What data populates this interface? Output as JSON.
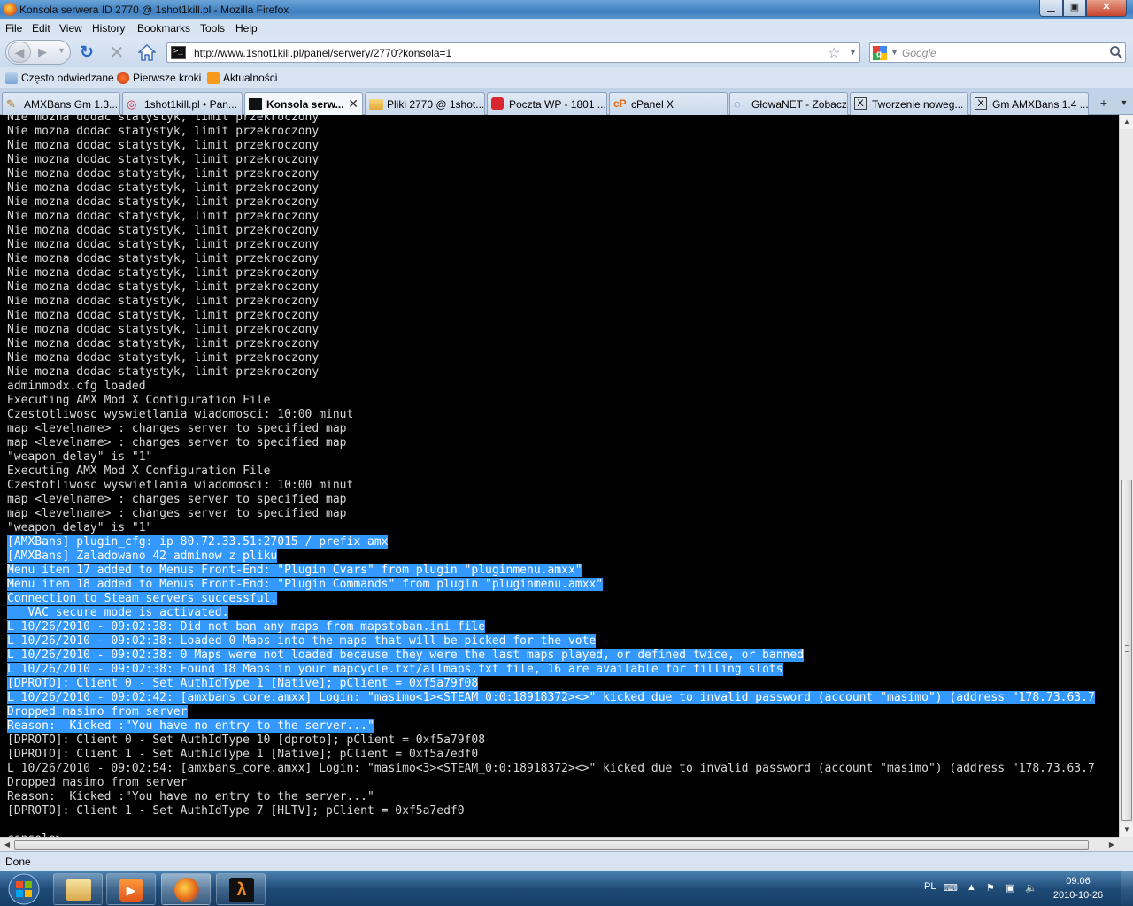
{
  "window": {
    "title": "Konsola serwera ID 2770 @ 1shot1kill.pl - Mozilla Firefox"
  },
  "menu": [
    "File",
    "Edit",
    "View",
    "History",
    "Bookmarks",
    "Tools",
    "Help"
  ],
  "nav": {
    "url": "http://www.1shot1kill.pl/panel/serwery/2770?konsola=1",
    "search_placeholder": "Google"
  },
  "bookmarks": [
    "Często odwiedzane",
    "Pierwsze kroki",
    "Aktualności"
  ],
  "tabs": [
    {
      "label": "AMXBans Gm 1.3...",
      "icon": "pen-icon"
    },
    {
      "label": "1shot1kill.pl • Pan...",
      "icon": "target-icon"
    },
    {
      "label": "Konsola serw...",
      "icon": "console-icon",
      "active": true
    },
    {
      "label": "Pliki 2770 @ 1shot...",
      "icon": "folder-icon"
    },
    {
      "label": "Poczta WP - 1801 ...",
      "icon": "wp-icon"
    },
    {
      "label": "cPanel X",
      "icon": "cpanel-icon"
    },
    {
      "label": "GłowaNET - Zobacz ...",
      "icon": "glowanet-icon"
    },
    {
      "label": "Tworzenie noweg...",
      "icon": "x-icon"
    },
    {
      "label": "Gm AMXBans 1.4 ...",
      "icon": "x-icon"
    }
  ],
  "console": {
    "lines": [
      "Nie mozna dodac statystyk, limit przekroczony",
      "Nie mozna dodac statystyk, limit przekroczony",
      "Nie mozna dodac statystyk, limit przekroczony",
      "Nie mozna dodac statystyk, limit przekroczony",
      "Nie mozna dodac statystyk, limit przekroczony",
      "Nie mozna dodac statystyk, limit przekroczony",
      "Nie mozna dodac statystyk, limit przekroczony",
      "Nie mozna dodac statystyk, limit przekroczony",
      "Nie mozna dodac statystyk, limit przekroczony",
      "Nie mozna dodac statystyk, limit przekroczony",
      "Nie mozna dodac statystyk, limit przekroczony",
      "Nie mozna dodac statystyk, limit przekroczony",
      "Nie mozna dodac statystyk, limit przekroczony",
      "Nie mozna dodac statystyk, limit przekroczony",
      "Nie mozna dodac statystyk, limit przekroczony",
      "Nie mozna dodac statystyk, limit przekroczony",
      "Nie mozna dodac statystyk, limit przekroczony",
      "Nie mozna dodac statystyk, limit przekroczony",
      "Nie mozna dodac statystyk, limit przekroczony",
      "adminmodx.cfg loaded",
      "Executing AMX Mod X Configuration File",
      "Czestotliwosc wyswietlania wiadomosci: 10:00 minut",
      "map <levelname> : changes server to specified map",
      "map <levelname> : changes server to specified map",
      "\"weapon_delay\" is \"1\"",
      "Executing AMX Mod X Configuration File",
      "Czestotliwosc wyswietlania wiadomosci: 10:00 minut",
      "map <levelname> : changes server to specified map",
      "map <levelname> : changes server to specified map",
      "\"weapon_delay\" is \"1\"",
      "[AMXBans] plugin_cfg: ip 80.72.33.51:27015 / prefix amx",
      "[AMXBans] Zaladowano 42 adminow z pliku",
      "Menu item 17 added to Menus Front-End: \"Plugin Cvars\" from plugin \"pluginmenu.amxx\"",
      "Menu item 18 added to Menus Front-End: \"Plugin Commands\" from plugin \"pluginmenu.amxx\"",
      "Connection to Steam servers successful.",
      "   VAC secure mode is activated.",
      "L 10/26/2010 - 09:02:38: Did not ban any maps from mapstoban.ini file",
      "L 10/26/2010 - 09:02:38: Loaded 0 Maps into the maps that will be picked for the vote",
      "L 10/26/2010 - 09:02:38: 0 Maps were not loaded because they were the last maps played, or defined twice, or banned",
      "L 10/26/2010 - 09:02:38: Found 18 Maps in your mapcycle.txt/allmaps.txt file, 16 are available for filling slots",
      "[DPROTO]: Client 0 - Set AuthIdType 1 [Native]; pClient = 0xf5a79f08",
      "L 10/26/2010 - 09:02:42: [amxbans_core.amxx] Login: \"masimo<1><STEAM_0:0:18918372><>\" kicked due to invalid password (account \"masimo\") (address \"178.73.63.7",
      "Dropped masimo from server",
      "Reason:  Kicked :\"You have no entry to the server...\"",
      "[DPROTO]: Client 0 - Set AuthIdType 10 [dproto]; pClient = 0xf5a79f08",
      "[DPROTO]: Client 1 - Set AuthIdType 1 [Native]; pClient = 0xf5a7edf0",
      "L 10/26/2010 - 09:02:54: [amxbans_core.amxx] Login: \"masimo<3><STEAM_0:0:18918372><>\" kicked due to invalid password (account \"masimo\") (address \"178.73.63.7",
      "Dropped masimo from server",
      "Reason:  Kicked :\"You have no entry to the server...\"",
      "[DPROTO]: Client 1 - Set AuthIdType 7 [HLTV]; pClient = 0xf5a7edf0",
      "",
      "console>"
    ],
    "selection": {
      "first_line": 30,
      "last_line": 43
    }
  },
  "status": {
    "text": "Done"
  },
  "taskbar": {
    "items": [
      "explorer-icon",
      "media-player-icon",
      "firefox-icon",
      "half-life-icon"
    ],
    "active_item": "firefox-icon",
    "tray": {
      "language": "PL",
      "time": "09:06",
      "date": "2010-10-26"
    }
  }
}
